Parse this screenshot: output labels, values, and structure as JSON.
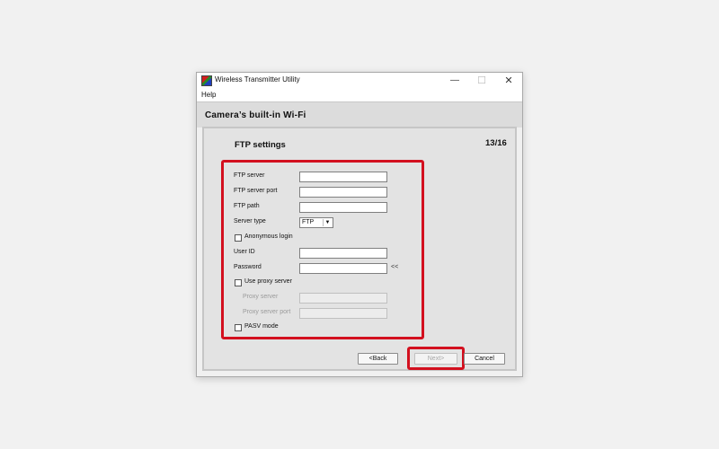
{
  "window": {
    "title": "Wireless Transmitter Utility",
    "controls": {
      "minimize": "—",
      "maximize": "☐",
      "close": "✕"
    }
  },
  "menu": {
    "items": [
      "Help"
    ]
  },
  "section": {
    "title": "Camera’s built-in Wi-Fi"
  },
  "panel": {
    "title": "FTP settings",
    "page": "13/16"
  },
  "form": {
    "ftp_server": {
      "label": "FTP server",
      "value": ""
    },
    "ftp_server_port": {
      "label": "FTP server port",
      "value": ""
    },
    "ftp_path": {
      "label": "FTP path",
      "value": ""
    },
    "server_type": {
      "label": "Server type",
      "value": "FTP"
    },
    "anonymous_login": {
      "label": "Anonymous login",
      "checked": false
    },
    "user_id": {
      "label": "User ID",
      "value": ""
    },
    "password": {
      "label": "Password",
      "value": "",
      "reveal": "<<"
    },
    "use_proxy": {
      "label": "Use proxy server",
      "checked": false
    },
    "proxy_server": {
      "label": "Proxy server",
      "value": "",
      "disabled": true
    },
    "proxy_server_port": {
      "label": "Proxy server port",
      "value": "",
      "disabled": true
    },
    "pasv_mode": {
      "label": "PASV mode",
      "checked": false
    }
  },
  "buttons": {
    "back": "<Back",
    "next": "Next>",
    "cancel": "Cancel"
  },
  "colors": {
    "highlight": "#d3101f",
    "background": "#f1f1f1",
    "window": "#f0f0f0"
  }
}
